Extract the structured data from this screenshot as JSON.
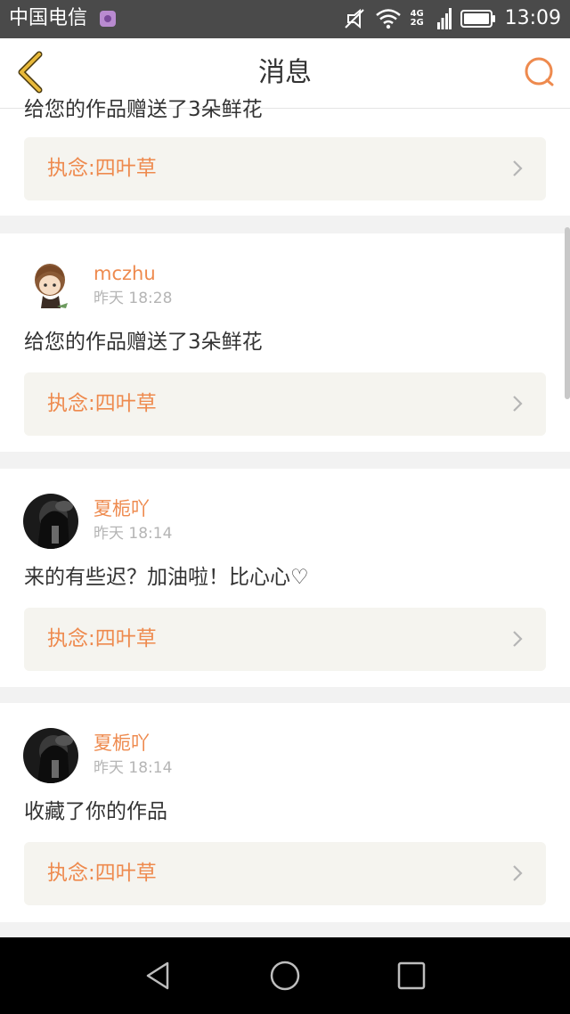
{
  "status_bar": {
    "carrier": "中国电信",
    "network_top": "4G",
    "network_bottom": "2G",
    "time": "13:09"
  },
  "header": {
    "title": "消息",
    "back_icon": "chevron-left-icon",
    "search_icon": "search-icon"
  },
  "colors": {
    "accent": "#ee8a4e",
    "back_icon": "#e8b93a",
    "work_bg": "#f5f4ef",
    "page_bg": "#f2f2f2"
  },
  "messages": [
    {
      "text": "给您的作品赠送了3朵鲜花",
      "work": "执念:四叶草"
    },
    {
      "user": "mczhu",
      "time": "昨天 18:28",
      "text": "给您的作品赠送了3朵鲜花",
      "work": "执念:四叶草"
    },
    {
      "user": "夏栀吖",
      "time": "昨天 18:14",
      "text": "来的有些迟？加油啦！比心心♡",
      "work": "执念:四叶草"
    },
    {
      "user": "夏栀吖",
      "time": "昨天 18:14",
      "text": "收藏了你的作品",
      "work": "执念:四叶草"
    }
  ],
  "nav_bar": {
    "back_icon": "triangle-back-icon",
    "home_icon": "circle-home-icon",
    "recents_icon": "square-recents-icon"
  }
}
